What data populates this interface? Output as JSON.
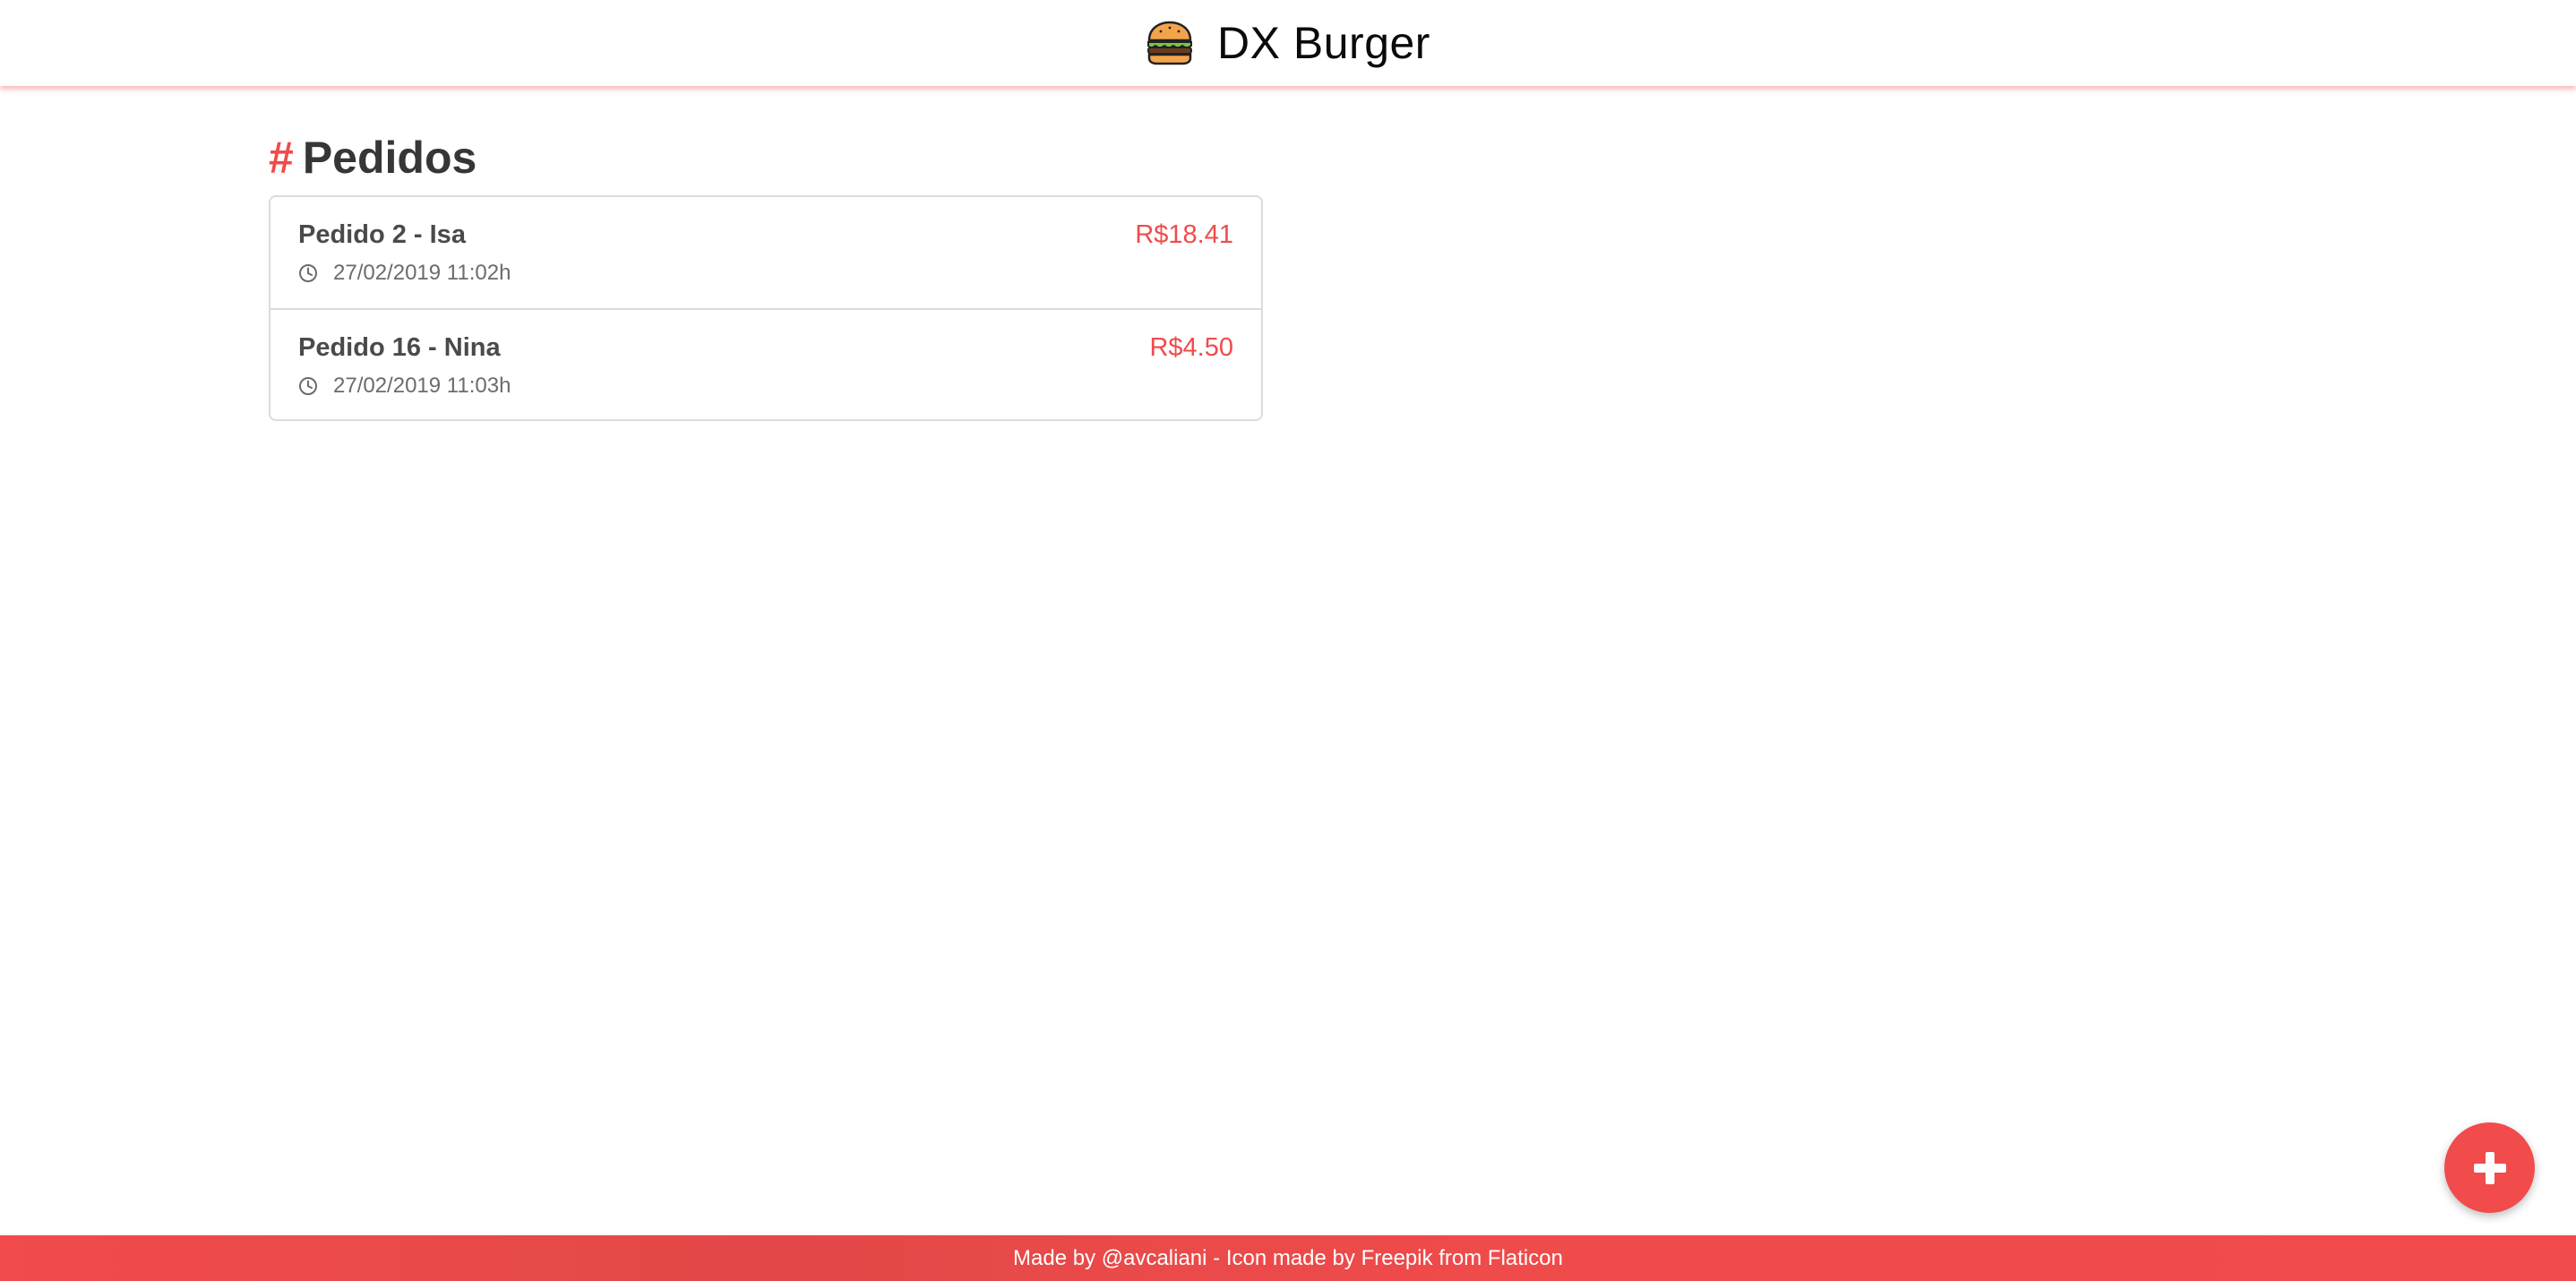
{
  "header": {
    "logo_icon": "burger-icon",
    "app_name": "DX Burger"
  },
  "main": {
    "title_prefix": "#",
    "title": "Pedidos",
    "orders": [
      {
        "title": "Pedido 2 - Isa",
        "price": "R$18.41",
        "time": "27/02/2019 11:02h",
        "time_icon": "clock-icon"
      },
      {
        "title": "Pedido 16 - Nina",
        "price": "R$4.50",
        "time": "27/02/2019 11:03h",
        "time_icon": "clock-icon"
      }
    ]
  },
  "fab": {
    "icon": "plus-icon"
  },
  "footer": {
    "text": "Made by @avcaliani - Icon made by Freepik from Flaticon"
  },
  "colors": {
    "accent": "#f14b4b",
    "text_dark": "#363636",
    "border": "#dcdcdc"
  }
}
